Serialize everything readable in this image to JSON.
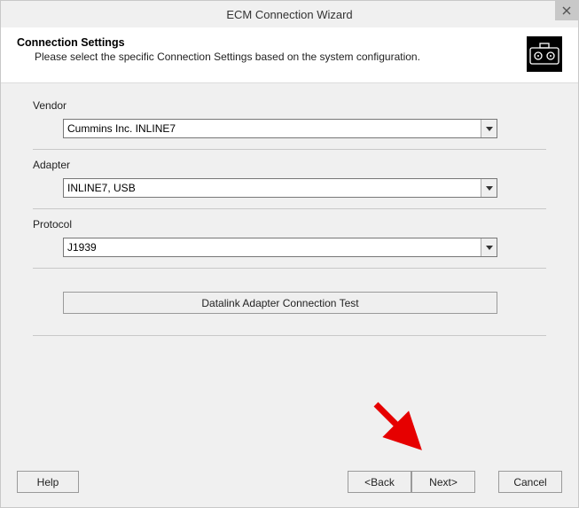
{
  "window": {
    "title": "ECM Connection Wizard"
  },
  "header": {
    "title": "Connection Settings",
    "subtitle": "Please select the specific Connection Settings based on the system configuration."
  },
  "fields": {
    "vendor": {
      "label": "Vendor",
      "value": "Cummins Inc. INLINE7"
    },
    "adapter": {
      "label": "Adapter",
      "value": "INLINE7, USB"
    },
    "protocol": {
      "label": "Protocol",
      "value": "J1939"
    }
  },
  "buttons": {
    "test": "Datalink Adapter Connection Test",
    "help": "Help",
    "back": "<Back",
    "next": "Next>",
    "cancel": "Cancel"
  }
}
